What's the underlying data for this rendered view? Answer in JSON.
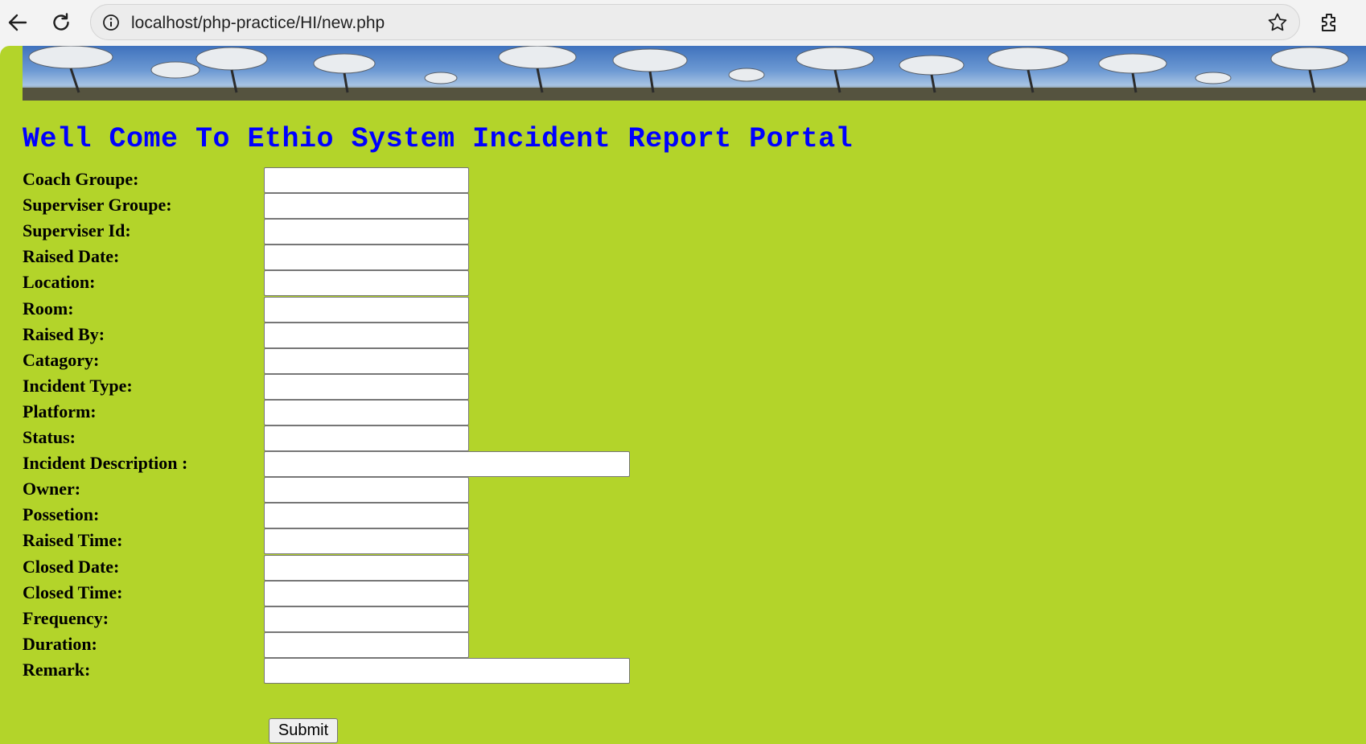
{
  "browser": {
    "url": "localhost/php-practice/HI/new.php",
    "icons": [
      "back-arrow-icon",
      "reload-icon",
      "site-info-icon",
      "bookmark-star-icon",
      "extensions-icon"
    ]
  },
  "page": {
    "background_color": "#b3d42a",
    "title": "Well Come To Ethio System Incident Report Portal",
    "title_color": "#0000ff"
  },
  "form": {
    "fields": [
      {
        "label": "Coach Groupe:",
        "value": ""
      },
      {
        "label": "Superviser Groupe:",
        "value": ""
      },
      {
        "label": "Superviser Id:",
        "value": ""
      },
      {
        "label": "Raised Date:",
        "value": ""
      },
      {
        "label": "Location:",
        "value": ""
      },
      {
        "label": "Room:",
        "value": ""
      },
      {
        "label": "Raised By:",
        "value": ""
      },
      {
        "label": "Catagory:",
        "value": ""
      },
      {
        "label": "Incident Type:",
        "value": ""
      },
      {
        "label": "Platform:",
        "value": ""
      },
      {
        "label": "Status:",
        "value": ""
      },
      {
        "label": "Incident Description :",
        "value": ""
      },
      {
        "label": "Owner:",
        "value": ""
      },
      {
        "label": "Possetion:",
        "value": ""
      },
      {
        "label": "Raised Time:",
        "value": ""
      },
      {
        "label": "Closed Date:",
        "value": ""
      },
      {
        "label": "Closed Time:",
        "value": ""
      },
      {
        "label": "Frequency:",
        "value": ""
      },
      {
        "label": "Duration:",
        "value": ""
      },
      {
        "label": "Remark:",
        "value": ""
      }
    ],
    "submit_label": "Submit"
  }
}
